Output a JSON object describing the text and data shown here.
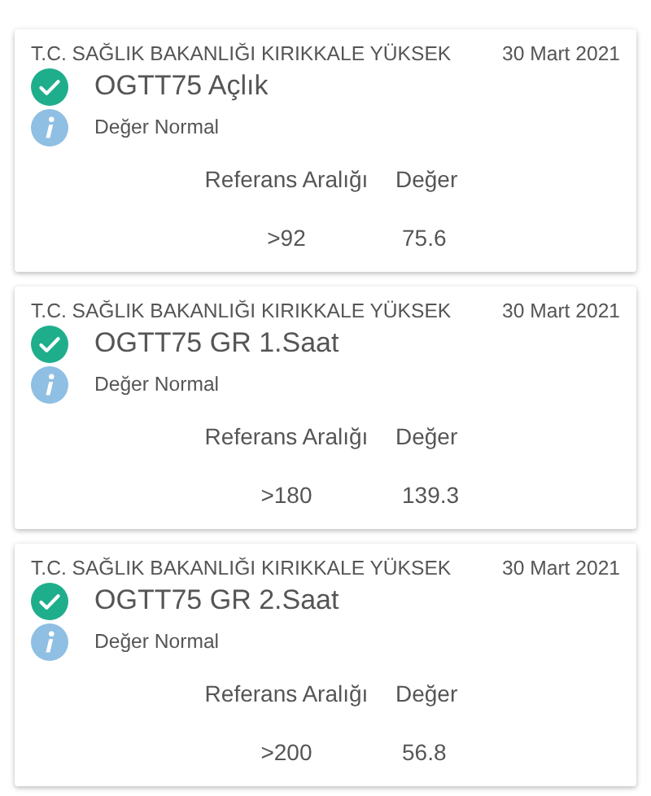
{
  "results": [
    {
      "institution": "T.C. SAĞLIK BAKANLIĞI KIRIKKALE YÜKSEK",
      "date": "30 Mart 2021",
      "test": "OGTT75 Açlık",
      "status": "Değer Normal",
      "reference_header": "Referans Aralığı",
      "value_header": "Değer",
      "reference": ">92",
      "value": "75.6"
    },
    {
      "institution": "T.C. SAĞLIK BAKANLIĞI KIRIKKALE YÜKSEK",
      "date": "30 Mart 2021",
      "test": "OGTT75 GR 1.Saat",
      "status": "Değer Normal",
      "reference_header": "Referans Aralığı",
      "value_header": "Değer",
      "reference": ">180",
      "value": "139.3"
    },
    {
      "institution": "T.C. SAĞLIK BAKANLIĞI KIRIKKALE YÜKSEK",
      "date": "30 Mart 2021",
      "test": "OGTT75 GR 2.Saat",
      "status": "Değer Normal",
      "reference_header": "Referans Aralığı",
      "value_header": "Değer",
      "reference": ">200",
      "value": "56.8"
    }
  ]
}
